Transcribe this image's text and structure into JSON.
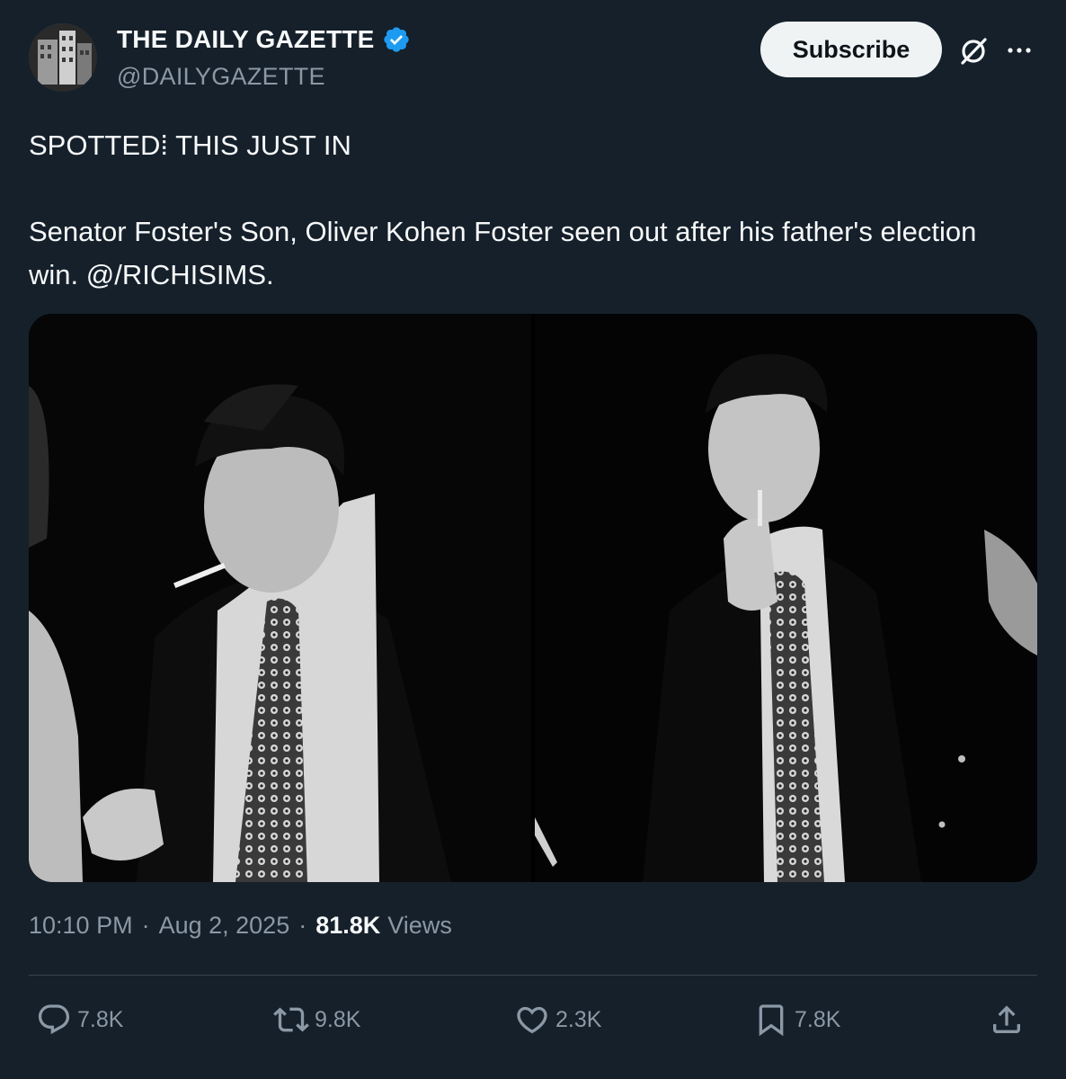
{
  "tweet": {
    "author": {
      "display_name": "THE DAILY GAZETTE",
      "handle": "@DAILYGAZETTE",
      "verified": true,
      "verified_color": "#1d9bf0"
    },
    "subscribe_label": "Subscribe",
    "text": {
      "line1": "SPOTTED⁞ THIS JUST IN",
      "line2": "Senator Foster's Son, Oliver Kohen Foster seen out after his father's election win. @/RICHISIMS."
    },
    "media": [
      {
        "icon": "photo"
      },
      {
        "icon": "photo"
      }
    ],
    "meta": {
      "time": "10:10 PM",
      "date": "Aug 2, 2025",
      "views_count": "81.8K",
      "views_label": "Views"
    },
    "actions": {
      "replies": "7.8K",
      "reposts": "9.8K",
      "likes": "2.3K",
      "bookmarks": "7.8K"
    }
  },
  "theme": {
    "background": "#15202b",
    "text": "#f7f9f9",
    "muted": "#8b98a5",
    "divider": "#38444d"
  }
}
